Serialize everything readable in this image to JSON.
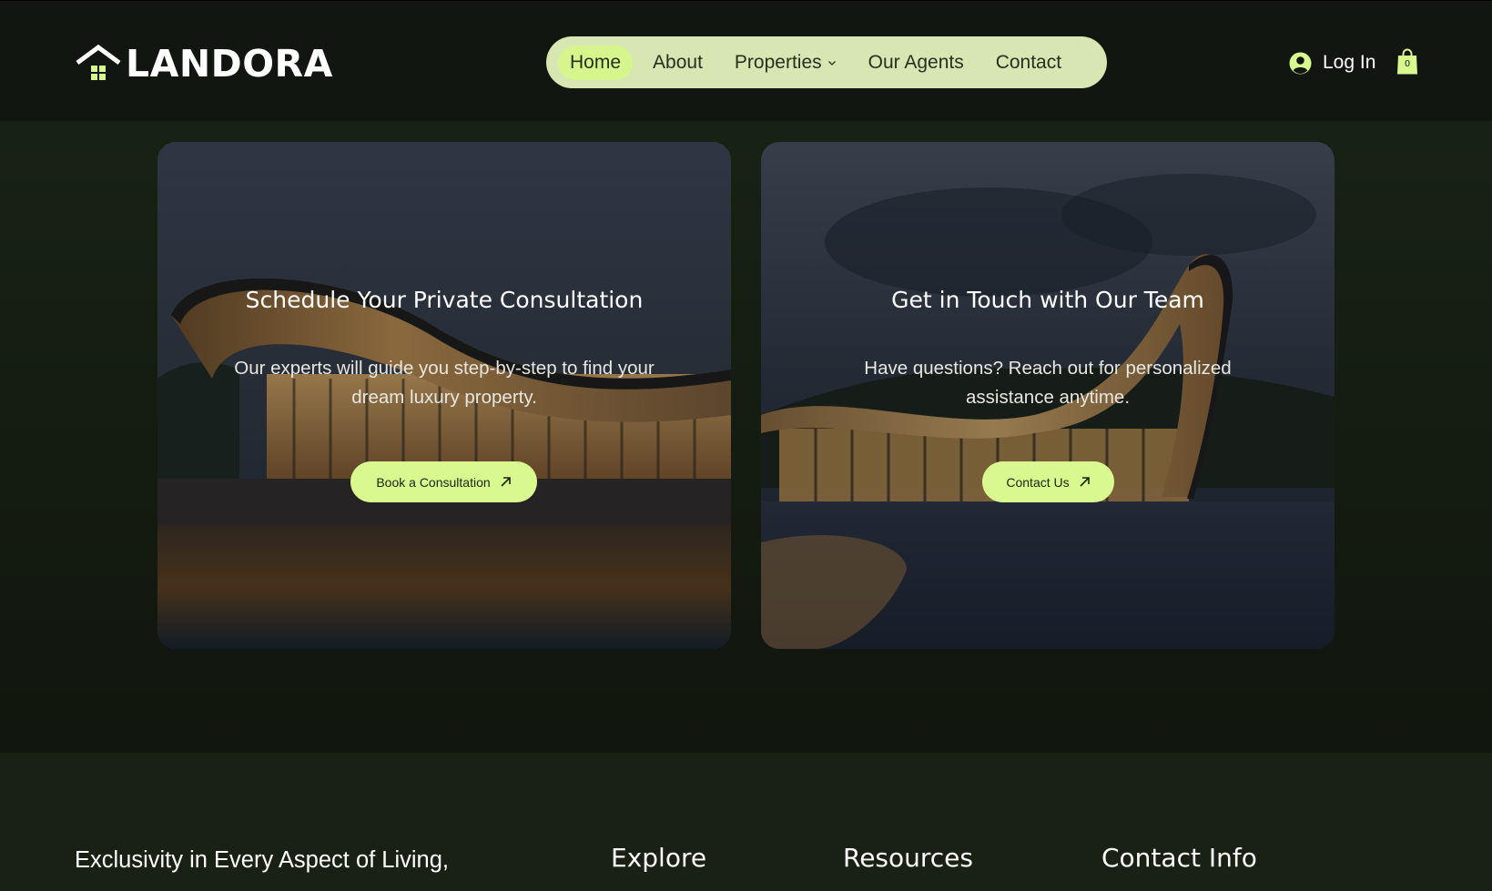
{
  "brand": {
    "name": "LANDORA"
  },
  "nav": {
    "items": [
      {
        "label": "Home",
        "active": true
      },
      {
        "label": "About"
      },
      {
        "label": "Properties",
        "has_dropdown": true
      },
      {
        "label": "Our Agents"
      },
      {
        "label": "Contact"
      }
    ]
  },
  "account": {
    "login_label": "Log In",
    "cart_count": "0"
  },
  "cards": [
    {
      "title": "Schedule Your Private Consultation",
      "text": "Our experts will guide you step-by-step to find your dream luxury property.",
      "button_label": "Book a Consultation"
    },
    {
      "title": "Get in Touch with Our Team",
      "text": "Have questions? Reach out for personalized assistance anytime.",
      "button_label": "Contact Us"
    }
  ],
  "footer": {
    "tagline": "Exclusivity in Every Aspect of Living,",
    "columns": [
      "Explore",
      "Resources",
      "Contact Info"
    ]
  },
  "colors": {
    "background": "#141a11",
    "header": "#111710",
    "nav_pill": "#d8e6b4",
    "accent": "#d9f88f"
  },
  "icons": [
    "home-logo-icon",
    "chevron-down-icon",
    "user-icon",
    "shopping-bag-icon",
    "arrow-up-right-icon"
  ]
}
